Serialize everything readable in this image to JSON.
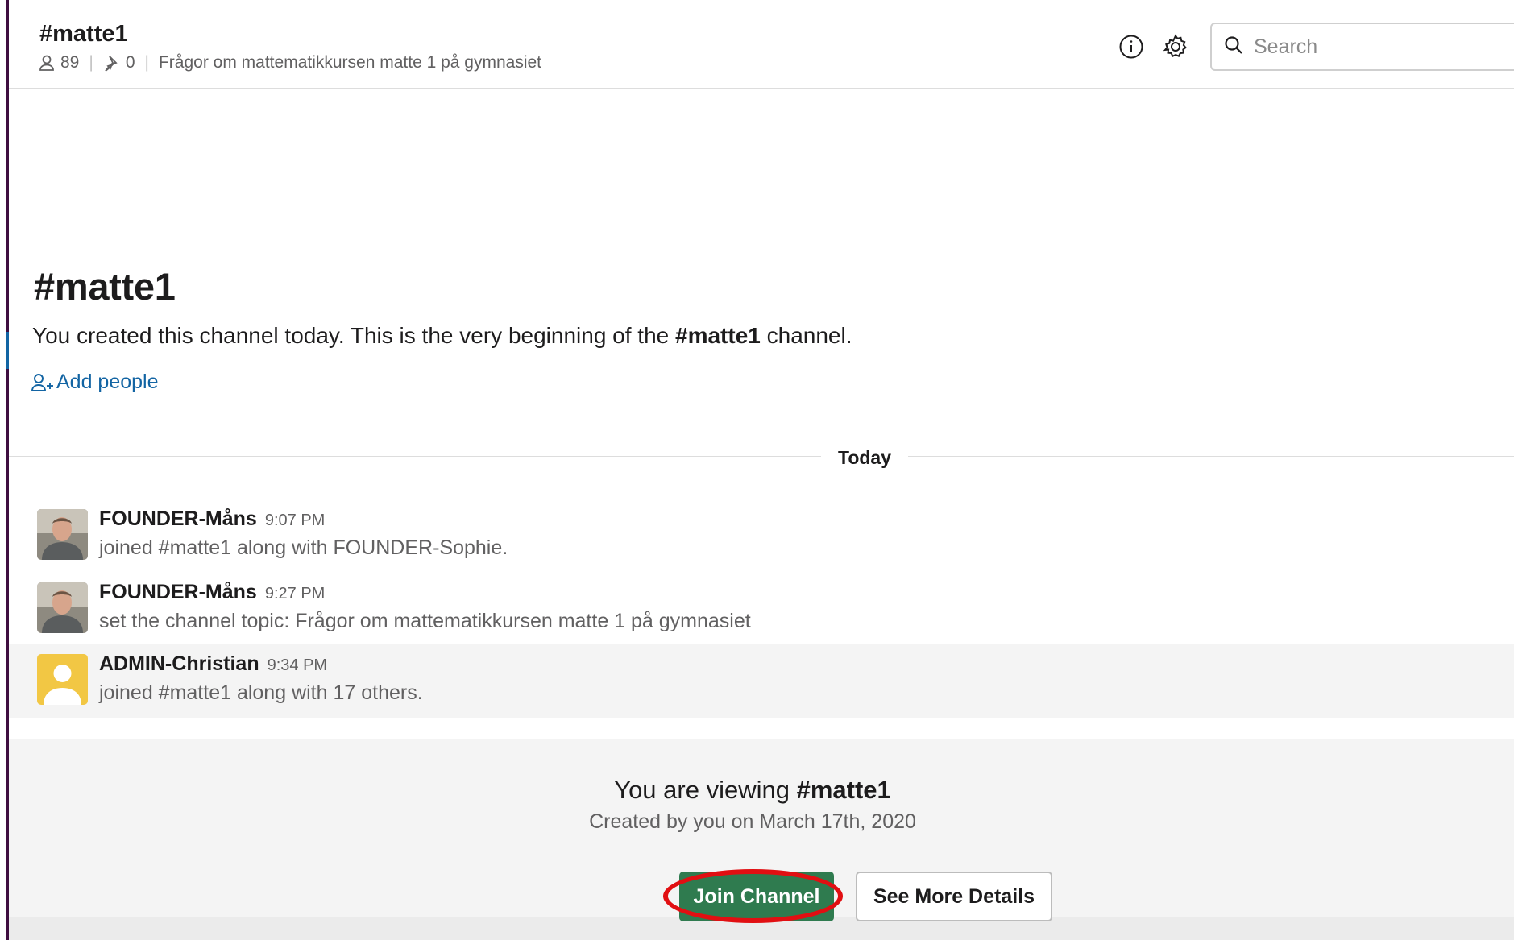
{
  "header": {
    "channel_title": "#matte1",
    "member_count": "89",
    "pinned_count": "0",
    "topic": "Frågor om mattematikkursen matte 1 på gymnasiet",
    "icons": [
      "info-icon",
      "gear-icon",
      "search-icon"
    ],
    "search": {
      "placeholder": "Search"
    }
  },
  "intro": {
    "title": "#matte1",
    "text_before": "You created this channel today. This is the very beginning of the ",
    "channel_ref": "#matte1",
    "text_after": " channel.",
    "add_people_label": "Add people"
  },
  "divider": {
    "label": "Today"
  },
  "messages": [
    {
      "name": "FOUNDER-Måns",
      "time": "9:07 PM",
      "text": "joined #matte1 along with FOUNDER-Sophie.",
      "avatar": "photo"
    },
    {
      "name": "FOUNDER-Måns",
      "time": "9:27 PM",
      "text": "set the channel topic: Frågor om mattematikkursen matte 1 på gymnasiet",
      "avatar": "photo"
    },
    {
      "name": "ADMIN-Christian",
      "time": "9:34 PM",
      "text": "joined #matte1 along with 17 others.",
      "avatar": "default-yellow"
    }
  ],
  "footer": {
    "viewing_prefix": "You are viewing ",
    "viewing_channel": "#matte1",
    "created": "Created by you on March 17th, 2020",
    "join_label": "Join Channel",
    "details_label": "See More Details"
  },
  "colors": {
    "accent": "#1264a3",
    "join_button": "#2f7b4f",
    "highlight_ring": "#e10f12",
    "sidebar": "#3f0e40"
  }
}
